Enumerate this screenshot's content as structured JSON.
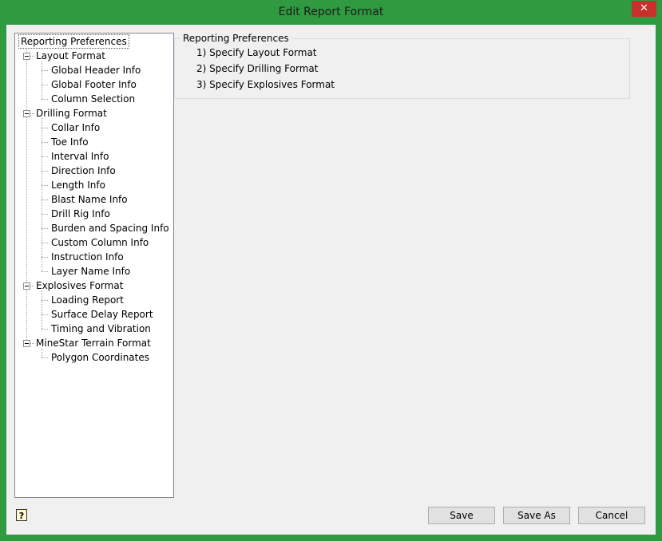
{
  "window": {
    "title": "Edit Report Format",
    "close_label": "✕"
  },
  "tree": {
    "root": "Reporting Preferences",
    "groups": [
      {
        "label": "Layout Format",
        "items": [
          "Global Header Info",
          "Global Footer Info",
          "Column Selection"
        ]
      },
      {
        "label": "Drilling Format",
        "items": [
          "Collar Info",
          "Toe Info",
          "Interval Info",
          "Direction Info",
          "Length Info",
          "Blast Name Info",
          "Drill Rig Info",
          "Burden and Spacing Info",
          "Custom Column Info",
          "Instruction Info",
          "Layer Name Info"
        ]
      },
      {
        "label": "Explosives Format",
        "items": [
          "Loading Report",
          "Surface Delay Report",
          "Timing and Vibration"
        ]
      },
      {
        "label": "MineStar Terrain Format",
        "items": [
          "Polygon Coordinates"
        ]
      }
    ]
  },
  "panel": {
    "legend": "Reporting Preferences",
    "steps": [
      "1) Specify Layout Format",
      "2) Specify Drilling Format",
      "3) Specify Explosives Format"
    ]
  },
  "footer": {
    "help_icon": "?",
    "save_label": "Save",
    "save_as_label": "Save As",
    "cancel_label": "Cancel"
  },
  "colors": {
    "frame": "#2f9a40",
    "close": "#c7302b",
    "client": "#f0f0f0"
  }
}
